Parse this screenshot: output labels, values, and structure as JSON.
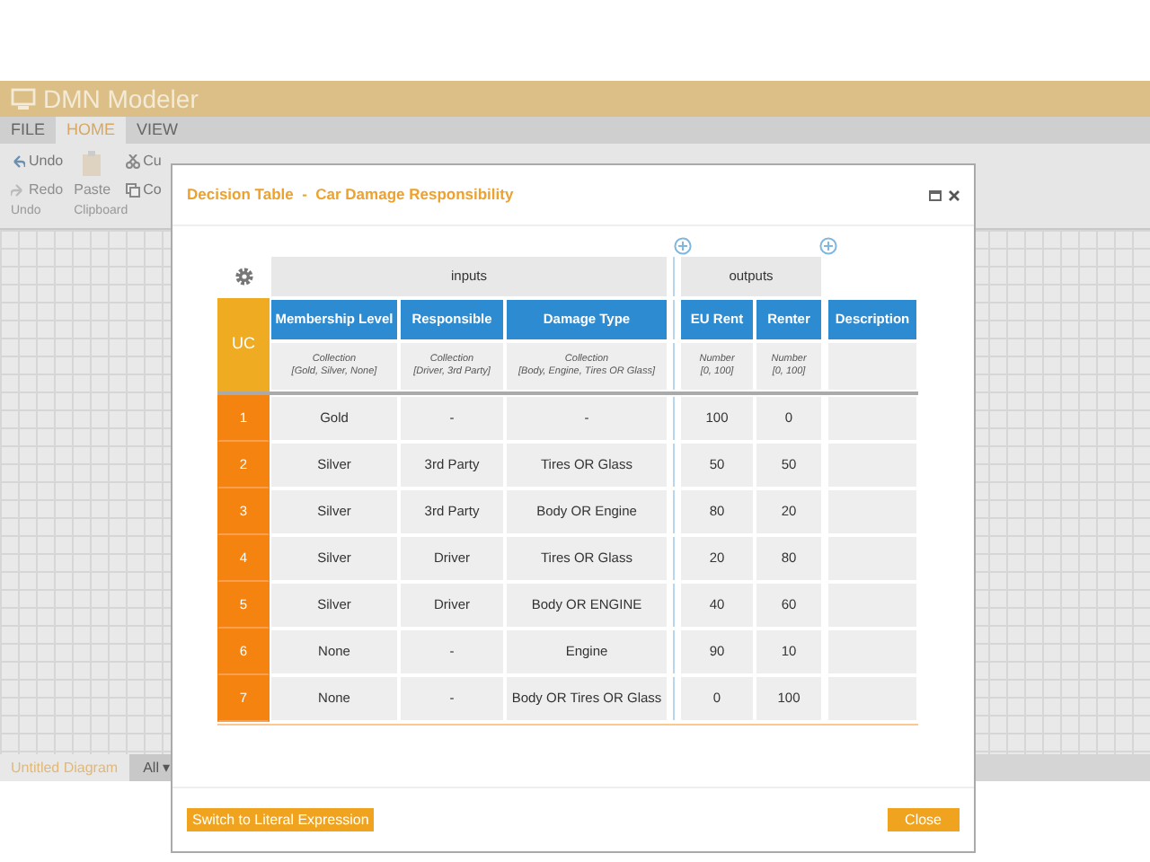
{
  "app": {
    "title": "DMN Modeler",
    "menu": [
      {
        "label": "FILE",
        "selected": false
      },
      {
        "label": "HOME",
        "selected": true
      },
      {
        "label": "VIEW",
        "selected": false
      }
    ],
    "ribbon": {
      "buttons": [
        {
          "label": "Undo",
          "kind": "undo",
          "disabled": false
        },
        {
          "label": "Redo",
          "kind": "redo",
          "disabled": true
        },
        {
          "label": "Paste",
          "kind": "paste",
          "disabled": true
        },
        {
          "label": "Cu",
          "kind": "cut",
          "disabled": false
        },
        {
          "label": "Co",
          "kind": "copy",
          "disabled": false
        }
      ],
      "groups": [
        "Undo",
        "Clipboard"
      ]
    },
    "diagram_tab": "Untitled Diagram",
    "filter": "All ▾"
  },
  "dialog": {
    "title": "Decision Table  -  Car Damage Responsibility",
    "table": {
      "hit_policy": "UC",
      "inputs_label": "inputs",
      "outputs_label": "outputs",
      "description_label": "Description",
      "columns": [
        {
          "kind": "input",
          "label": "Membership Level",
          "type": "Collection",
          "constraint": "[Gold, Silver, None]"
        },
        {
          "kind": "input",
          "label": "Responsible",
          "type": "Collection",
          "constraint": "[Driver, 3rd Party]"
        },
        {
          "kind": "input",
          "label": "Damage Type",
          "type": "Collection",
          "constraint": "[Body, Engine, Tires OR Glass]"
        },
        {
          "kind": "output",
          "label": "EU Rent",
          "type": "Number",
          "constraint": "[0, 100]"
        },
        {
          "kind": "output",
          "label": "Renter",
          "type": "Number",
          "constraint": "[0, 100]"
        }
      ],
      "rules": [
        {
          "number": "1",
          "cells": [
            "Gold",
            "-",
            "-",
            "100",
            "0"
          ]
        },
        {
          "number": "2",
          "cells": [
            "Silver",
            "3rd Party",
            "Tires OR Glass",
            "50",
            "50"
          ]
        },
        {
          "number": "3",
          "cells": [
            "Silver",
            "3rd Party",
            "Body OR Engine",
            "80",
            "20"
          ]
        },
        {
          "number": "4",
          "cells": [
            "Silver",
            "Driver",
            "Tires OR Glass",
            "20",
            "80"
          ]
        },
        {
          "number": "5",
          "cells": [
            "Silver",
            "Driver",
            "Body OR ENGINE",
            "40",
            "60"
          ]
        },
        {
          "number": "6",
          "cells": [
            "None",
            "-",
            "Engine",
            "90",
            "10"
          ]
        },
        {
          "number": "7",
          "cells": [
            "None",
            "-",
            "Body OR Tires OR Glass",
            "0",
            "100"
          ]
        }
      ]
    },
    "buttons": [
      {
        "label": "Switch to Literal Expression",
        "kind": "switch"
      },
      {
        "label": "Close",
        "kind": "close"
      }
    ]
  }
}
